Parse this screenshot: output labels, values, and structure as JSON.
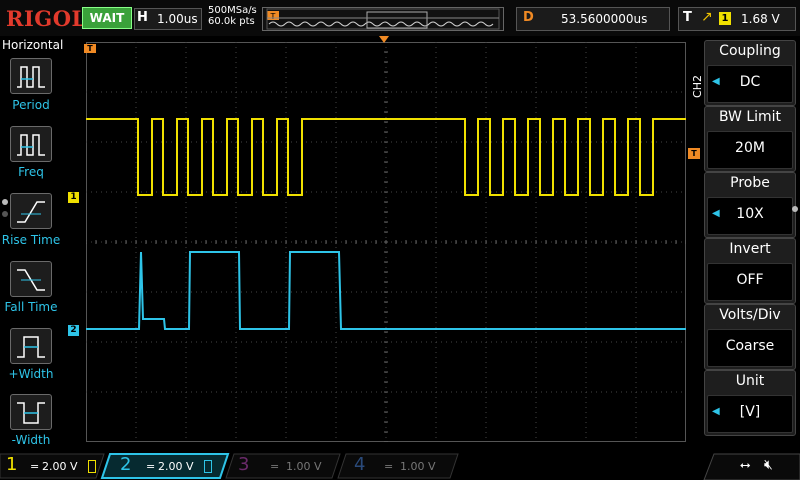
{
  "topbar": {
    "brand": "RIGOL",
    "run_state": "WAIT",
    "timebase_key": "H",
    "timebase_value": "1.00us",
    "sample_rate": "500MSa/s",
    "memory_depth": "60.0k pts",
    "trigger_pos_marker": "T",
    "delay_key": "D",
    "delay_value": "53.5600000us",
    "trigger_key": "T",
    "trigger_source": "1",
    "trigger_level": "1.68 V"
  },
  "left_menu": {
    "title": "Horizontal",
    "items": [
      {
        "label": "Period",
        "icon": "period-icon"
      },
      {
        "label": "Freq",
        "icon": "freq-icon"
      },
      {
        "label": "Rise Time",
        "icon": "rise-time-icon"
      },
      {
        "label": "Fall Time",
        "icon": "fall-time-icon"
      },
      {
        "label": "+Width",
        "icon": "pos-width-icon"
      },
      {
        "label": "-Width",
        "icon": "neg-width-icon"
      }
    ]
  },
  "right_menu": {
    "channel_tag": "CH2",
    "items": [
      {
        "title": "Coupling",
        "value": "DC"
      },
      {
        "title": "BW Limit",
        "value": "20M"
      },
      {
        "title": "Probe",
        "value": "10X"
      },
      {
        "title": "Invert",
        "value": "OFF"
      },
      {
        "title": "Volts/Div",
        "value": "Coarse"
      },
      {
        "title": "Unit",
        "value": "[V]"
      }
    ]
  },
  "screen": {
    "ch1_marker": "1",
    "ch2_marker": "2",
    "trigger_level_marker": "T",
    "trigger_time_marker": "T"
  },
  "bottombar": {
    "channels": [
      {
        "num": "1",
        "coupling": "=",
        "scale": "2.00 V",
        "color": "#f0e000",
        "active": true
      },
      {
        "num": "2",
        "coupling": "=",
        "scale": "2.00 V",
        "color": "#2ec4e8",
        "active": true,
        "selected": true
      },
      {
        "num": "3",
        "coupling": "=",
        "scale": "1.00 V",
        "color": "#b04ab0",
        "active": false
      },
      {
        "num": "4",
        "coupling": "=",
        "scale": "1.00 V",
        "color": "#3a6ab8",
        "active": false
      }
    ]
  },
  "colors": {
    "ch1": "#f0e000",
    "ch2": "#2ec4e8",
    "brand": "#e23a2c",
    "trigger": "#f08a24",
    "wait": "#3aa13a"
  }
}
